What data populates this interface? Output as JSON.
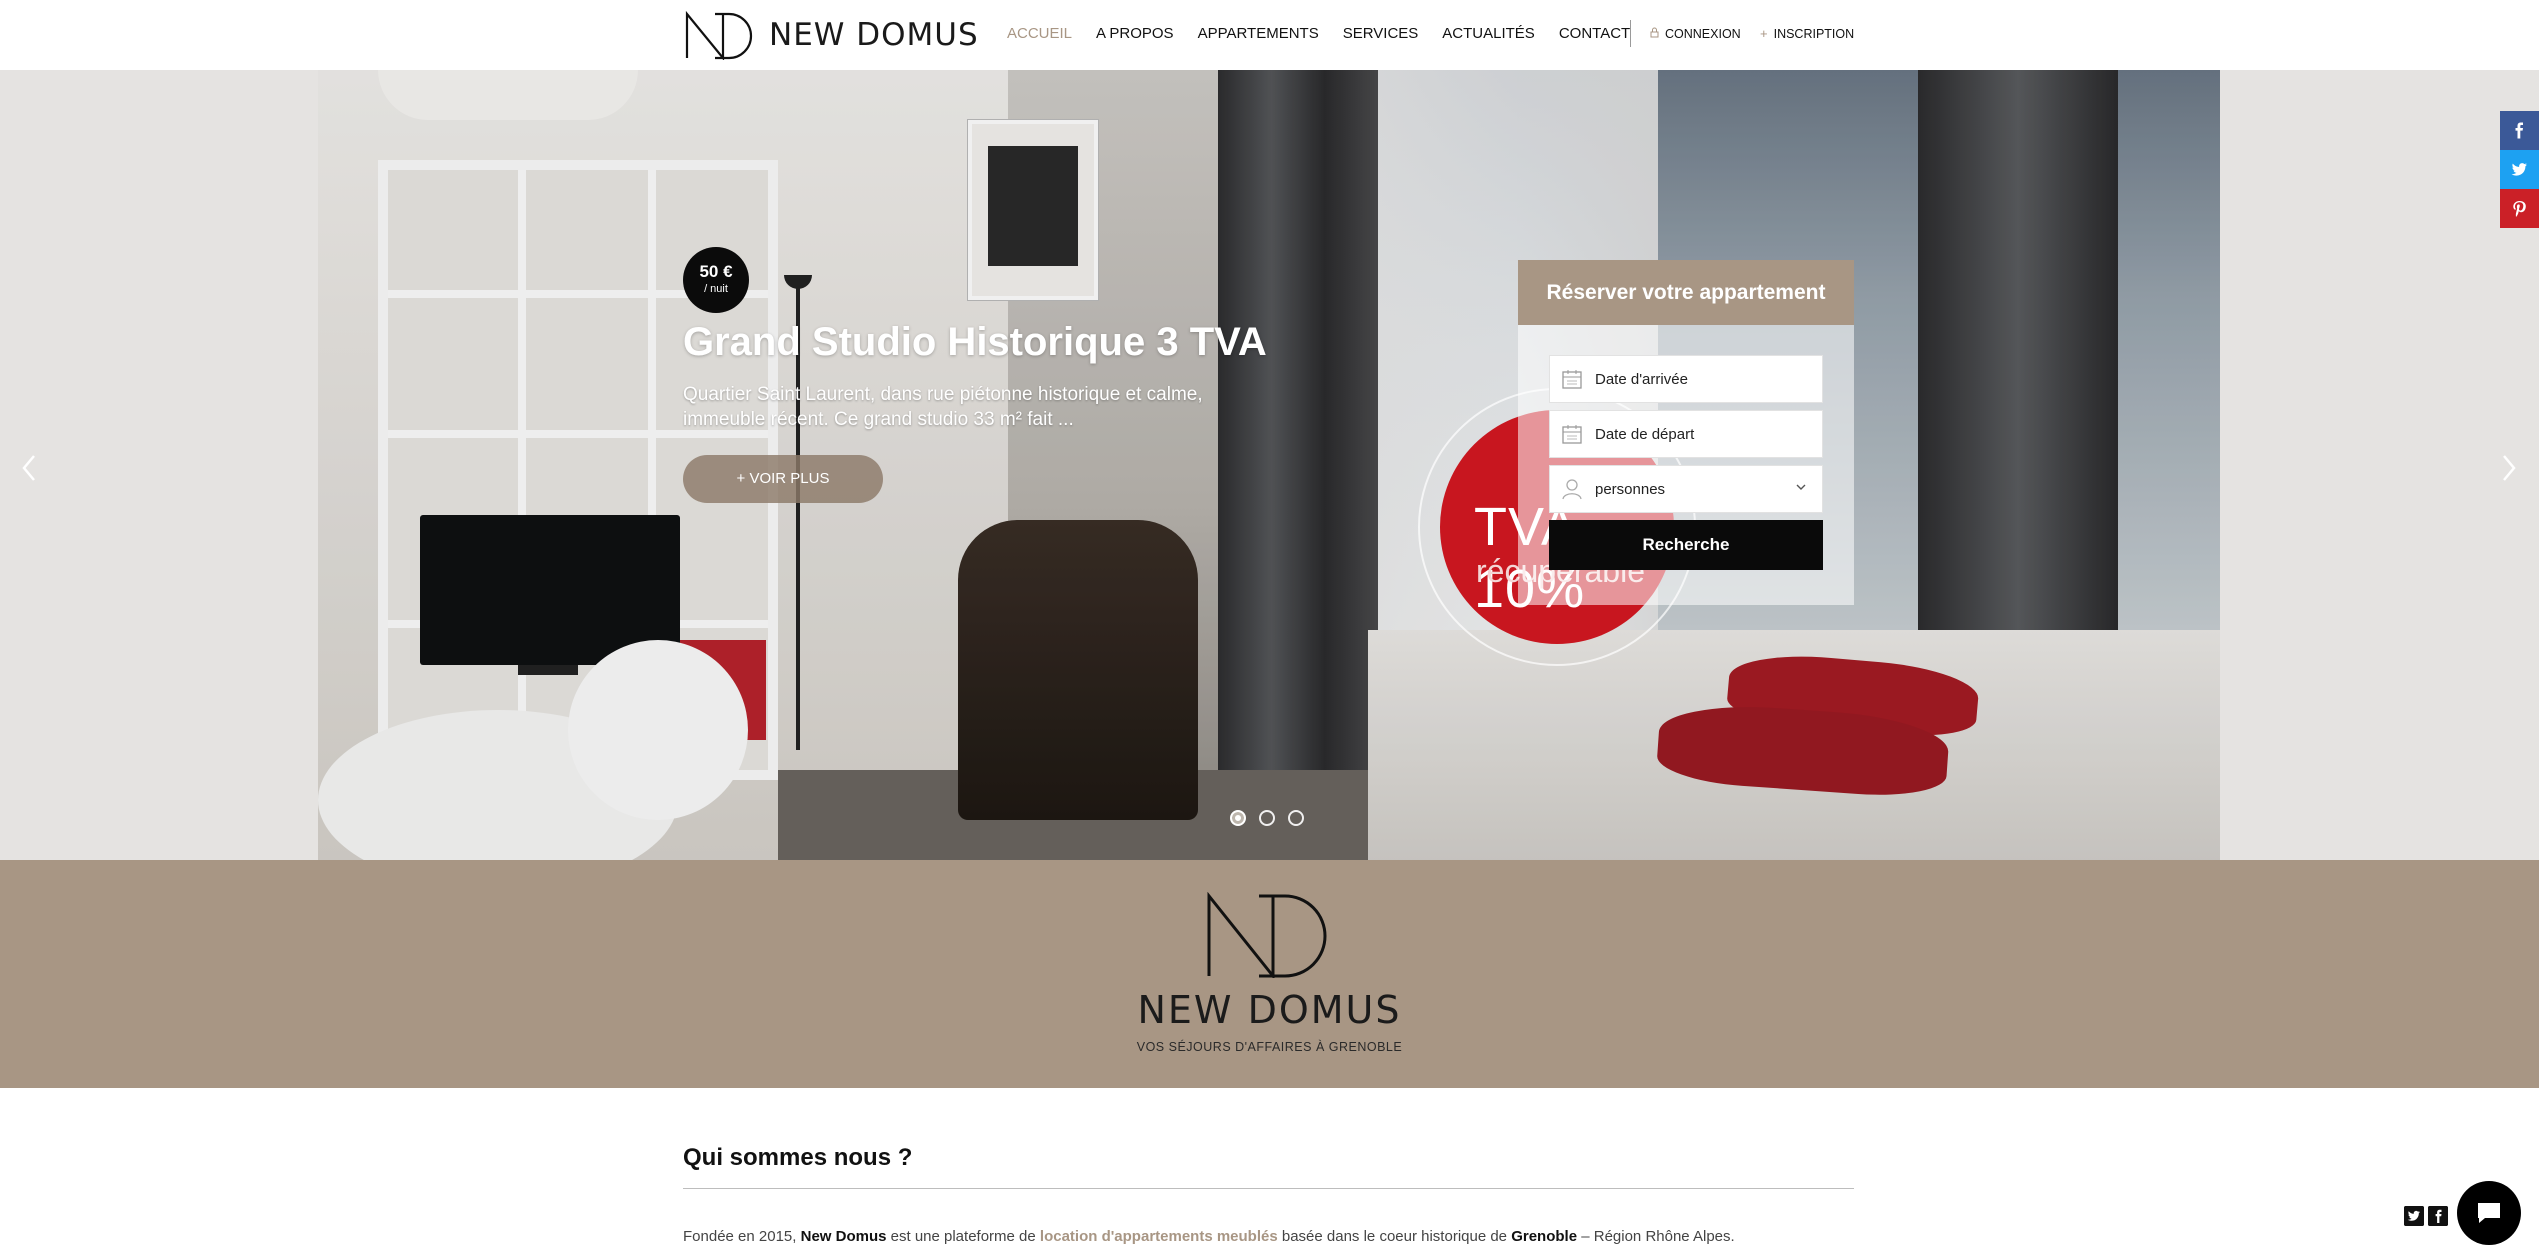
{
  "brand": {
    "name": "NEW DOMUS",
    "tagline": "VOS SÉJOURS D'AFFAIRES À GRENOBLE"
  },
  "nav": {
    "items": [
      {
        "label": "ACCUEIL",
        "active": true
      },
      {
        "label": "A PROPOS"
      },
      {
        "label": "APPARTEMENTS"
      },
      {
        "label": "SERVICES"
      },
      {
        "label": "ACTUALITÉS"
      },
      {
        "label": "CONTACT"
      }
    ],
    "login": "CONNEXION",
    "signup": "INSCRIPTION"
  },
  "hero": {
    "price": "50 €",
    "price_unit": "/ nuit",
    "title": "Grand Studio Historique 3 TVA",
    "description": "Quartier Saint Laurent, dans rue piétonne historique et calme, immeuble récent. Ce grand studio 33 m² fait ...",
    "cta": "+ VOIR PLUS",
    "badge_line1": "TVA 10%",
    "badge_line2": "récupérable",
    "slides_total": 3,
    "active_slide": 1
  },
  "booking": {
    "title": "Réserver votre appartement",
    "arrival_placeholder": "Date d'arrivée",
    "departure_placeholder": "Date de départ",
    "guests_label": "personnes",
    "search_button": "Recherche"
  },
  "about": {
    "title": "Qui sommes nous ?",
    "text_part1": "Fondée en 2015, ",
    "text_bold1": "New Domus",
    "text_part2": " est une plateforme de ",
    "text_link": "location d'appartements meublés",
    "text_part3": " basée dans le coeur historique de ",
    "text_bold2": "Grenoble",
    "text_part4": " – Région Rhône Alpes."
  },
  "social": {
    "facebook_color": "#3b5998",
    "twitter_color": "#1da1f2",
    "pinterest_color": "#cb2027"
  },
  "colors": {
    "accent": "#a89684",
    "dark": "#0a0a0a",
    "badge_red": "#c8161f"
  },
  "icons": [
    "calendar-icon",
    "user-icon",
    "chevron-down-icon",
    "lock-icon",
    "plus-icon",
    "chat-icon",
    "facebook-icon",
    "twitter-icon",
    "pinterest-icon"
  ]
}
